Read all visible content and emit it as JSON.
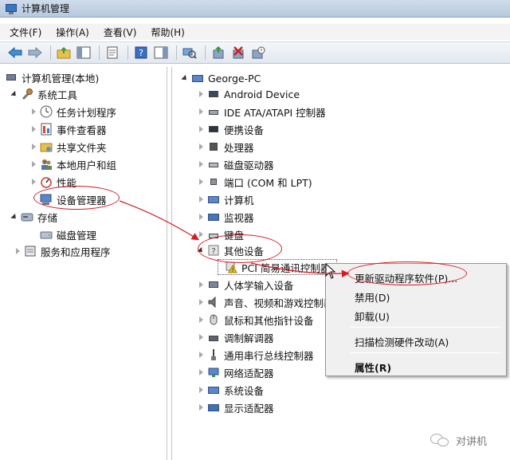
{
  "window": {
    "title": "计算机管理"
  },
  "menubar": {
    "items": [
      "文件(F)",
      "操作(A)",
      "查看(V)",
      "帮助(H)"
    ]
  },
  "toolbar": {
    "icons": [
      "back-arrow-icon",
      "forward-arrow-icon",
      "up-folder-icon",
      "show-hide-tree-icon",
      "properties-icon",
      "help-icon",
      "action-pane-icon",
      "scan-hardware-icon",
      "update-driver-icon",
      "uninstall-icon",
      "disable-device-icon"
    ]
  },
  "left_tree": {
    "root": "计算机管理(本地)",
    "system_tools": "系统工具",
    "task_scheduler": "任务计划程序",
    "event_viewer": "事件查看器",
    "shared_folders": "共享文件夹",
    "local_users": "本地用户和组",
    "performance": "性能",
    "device_manager": "设备管理器",
    "storage": "存储",
    "disk_management": "磁盘管理",
    "services_apps": "服务和应用程序"
  },
  "device_tree": {
    "root": "George-PC",
    "categories": [
      "Android Device",
      "IDE ATA/ATAPI 控制器",
      "便携设备",
      "处理器",
      "磁盘驱动器",
      "端口 (COM 和 LPT)",
      "计算机",
      "监视器",
      "键盘",
      "其他设备",
      "PCI 简易通讯控制器",
      "人体学输入设备",
      "声音、视频和游戏控制器",
      "鼠标和其他指针设备",
      "调制解调器",
      "通用串行总线控制器",
      "网络适配器",
      "系统设备",
      "显示适配器"
    ]
  },
  "context_menu": {
    "update_driver": "更新驱动程序软件(P)...",
    "disable": "禁用(D)",
    "uninstall": "卸载(U)",
    "scan": "扫描检测硬件改动(A)",
    "properties": "属性(R)"
  },
  "annotations": {
    "color": "#d71a21"
  },
  "watermark": {
    "text": "对讲机"
  }
}
